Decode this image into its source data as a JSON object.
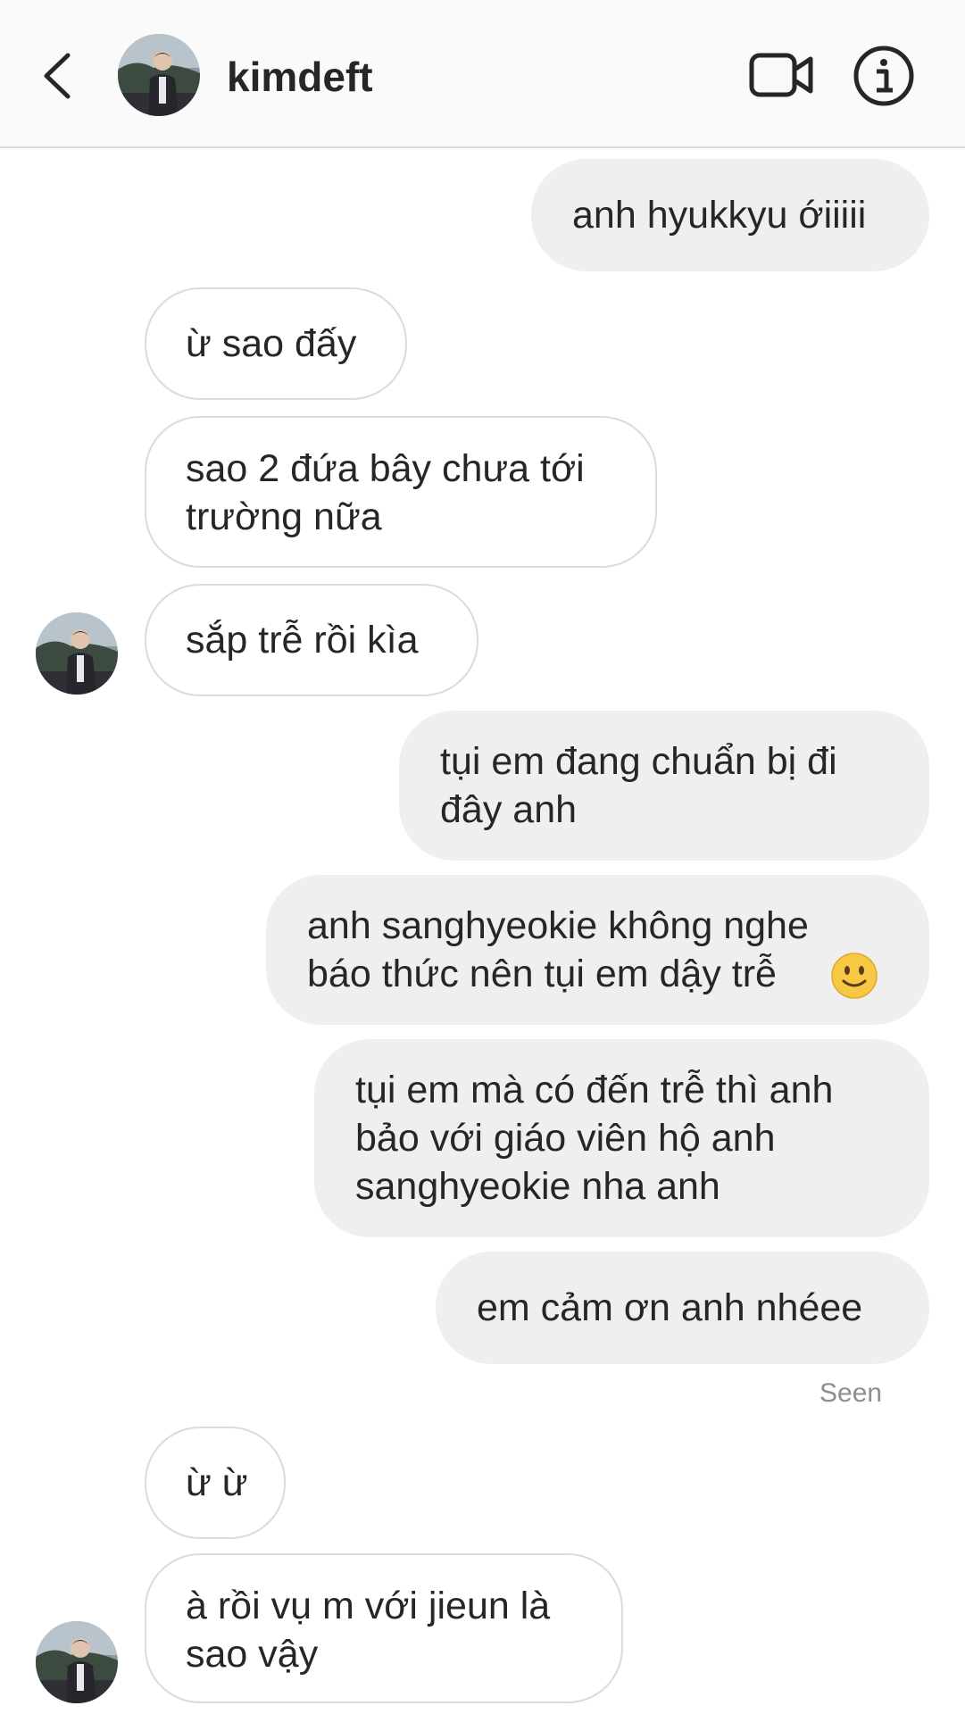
{
  "header": {
    "username": "kimdeft",
    "back_icon": "chevron-left-icon",
    "video_icon": "video-camera-icon",
    "info_icon": "info-icon"
  },
  "messages": [
    {
      "direction": "outgoing",
      "lines": [
        "anh hyukkyu ớiiiii"
      ]
    },
    {
      "direction": "incoming",
      "lines": [
        "ừ sao đấy"
      ]
    },
    {
      "direction": "incoming",
      "lines": [
        "sao 2 đứa bây chưa tới",
        "trường nữa"
      ]
    },
    {
      "direction": "incoming",
      "lines": [
        "sắp trễ rồi kìa"
      ]
    },
    {
      "direction": "outgoing",
      "lines": [
        "tụi em đang chuẩn bị đi",
        "đây anh"
      ]
    },
    {
      "direction": "outgoing",
      "lines": [
        "anh sanghyeokie không nghe",
        "báo thức nên tụi em dậy trễ"
      ],
      "emoji": "slightly-smiling-face"
    },
    {
      "direction": "outgoing",
      "lines": [
        "tụi em mà có đến trễ thì anh",
        "bảo với giáo viên hộ anh",
        "sanghyeokie nha anh"
      ]
    },
    {
      "direction": "outgoing",
      "lines": [
        "em cảm ơn anh nhéee"
      ]
    },
    {
      "direction": "incoming",
      "lines": [
        "ừ ừ"
      ]
    },
    {
      "direction": "incoming",
      "lines": [
        "à rồi vụ m với jieun là",
        "sao vậy"
      ]
    }
  ],
  "status": {
    "seen_label": "Seen"
  }
}
